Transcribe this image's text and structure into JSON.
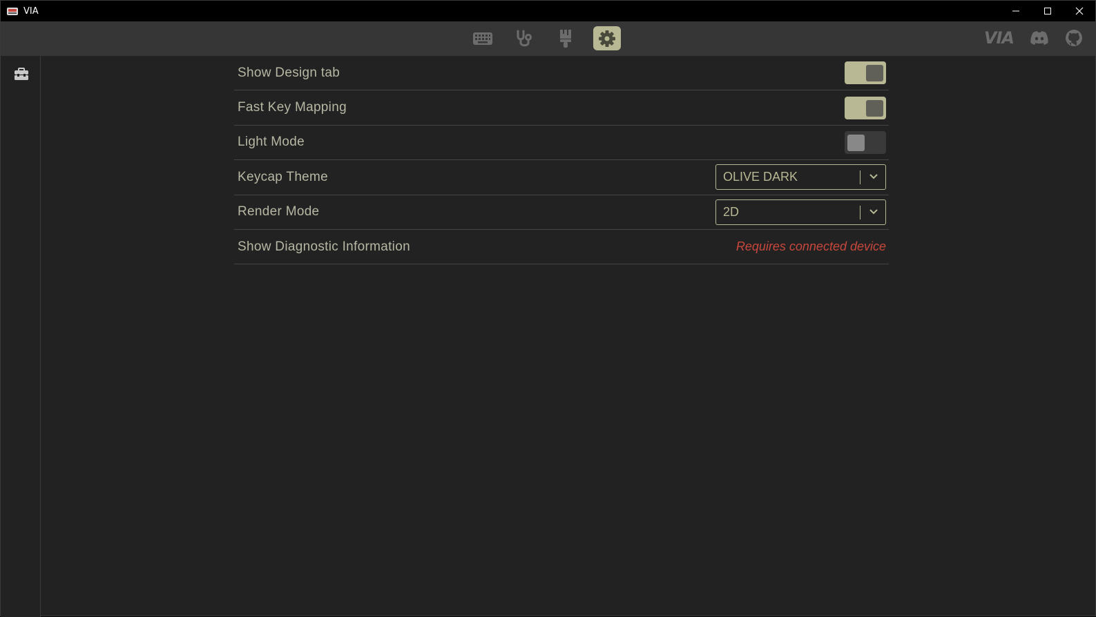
{
  "window": {
    "title": "VIA"
  },
  "nav": {
    "items": [
      {
        "name": "keyboard",
        "icon": "keyboard-icon"
      },
      {
        "name": "test",
        "icon": "stethoscope-icon"
      },
      {
        "name": "design",
        "icon": "paintbrush-icon"
      },
      {
        "name": "settings",
        "icon": "gear-icon",
        "active": true
      }
    ],
    "right": {
      "logo": "VIA",
      "discord_icon": "discord-icon",
      "github_icon": "github-icon"
    }
  },
  "sidebar": {
    "items": [
      {
        "icon": "toolbox-icon"
      }
    ]
  },
  "settings": {
    "show_design_tab": {
      "label": "Show Design tab",
      "enabled": true
    },
    "fast_key_mapping": {
      "label": "Fast Key Mapping",
      "enabled": true
    },
    "light_mode": {
      "label": "Light Mode",
      "enabled": false
    },
    "keycap_theme": {
      "label": "Keycap Theme",
      "value": "OLIVE DARK"
    },
    "render_mode": {
      "label": "Render Mode",
      "value": "2D"
    },
    "diagnostic": {
      "label": "Show Diagnostic Information",
      "status": "Requires connected device"
    }
  },
  "colors": {
    "accent": "#b8b894",
    "background": "#222222",
    "nav": "#363636",
    "warning": "#c8473d"
  }
}
